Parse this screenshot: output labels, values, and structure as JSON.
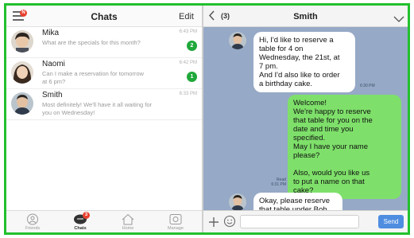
{
  "list": {
    "title": "Chats",
    "edit_label": "Edit",
    "menu_badge": "N",
    "chats": [
      {
        "name": "Mika",
        "preview": "What are the specials for this month?",
        "time": "6:43 PM",
        "unread": "2"
      },
      {
        "name": "Naomi",
        "preview": "Can I make a reservation for tomorrow at 6 pm?",
        "time": "6:42 PM",
        "unread": "1"
      },
      {
        "name": "Smith",
        "preview": "Most definitely! We'll have it all waiting for you on Wednesday!",
        "time": "6:33 PM",
        "unread": ""
      }
    ]
  },
  "tabs": [
    {
      "label": "Friends",
      "icon": "friends-icon"
    },
    {
      "label": "Chats",
      "icon": "chats-icon",
      "badge": "3"
    },
    {
      "label": "Home",
      "icon": "home-icon"
    },
    {
      "label": "Manage",
      "icon": "manage-icon"
    }
  ],
  "chat": {
    "unread_count": "(3)",
    "title": "Smith",
    "messages": [
      {
        "side": "in",
        "text": "Hi, I'd like to reserve a\ntable for 4 on\nWednesday, the 21st, at\n7 pm.\nAnd I'd also like to order\na birthday cake.",
        "time": "6:30 PM"
      },
      {
        "side": "out",
        "text": "Welcome!\nWe're happy to reserve\nthat table for you on the\ndate and time you\nspecified.\nMay I have your name\nplease?\n\nAlso, would you like us\nto put a name on that\ncake?",
        "read": "Read",
        "time": "6:31 PM"
      },
      {
        "side": "in",
        "text": "Okay, please reserve\nthat table under Bob\nSmith."
      }
    ],
    "send_label": "Send",
    "input_value": ""
  },
  "colors": {
    "frame": "#22c02e",
    "chat_background": "#96a9c6",
    "outgoing_bubble": "#7ee06a",
    "unread_badge": "#1fa83a",
    "notification_badge": "#e8412f",
    "send_button": "#4f8de0"
  }
}
